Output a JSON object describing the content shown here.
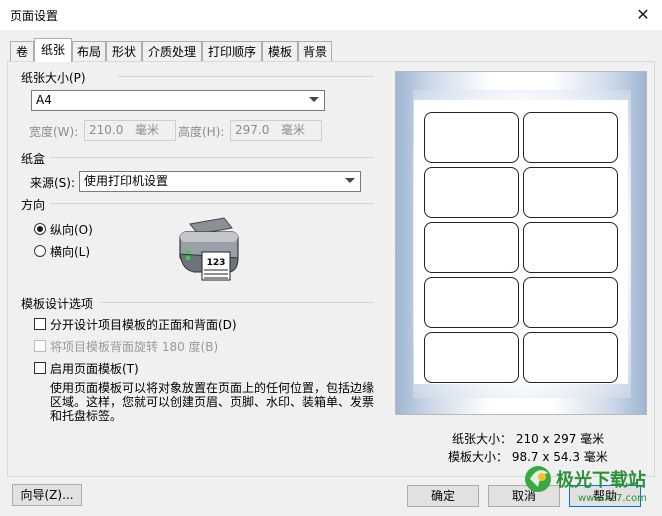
{
  "window": {
    "title": "页面设置",
    "close_glyph": "✕"
  },
  "tabs": [
    {
      "label": "卷"
    },
    {
      "label": "纸张"
    },
    {
      "label": "布局"
    },
    {
      "label": "形状"
    },
    {
      "label": "介质处理"
    },
    {
      "label": "打印顺序"
    },
    {
      "label": "模板"
    },
    {
      "label": "背景"
    }
  ],
  "active_tab": "纸张",
  "paper_size": {
    "group_label": "纸张大小(P)",
    "selected": "A4",
    "width_label": "宽度(W):",
    "width_value": "210.0",
    "width_unit": "毫米",
    "height_label": "高度(H):",
    "height_value": "297.0",
    "height_unit": "毫米"
  },
  "tray": {
    "group_label": "纸盒",
    "source_label": "来源(S):",
    "source_value": "使用打印机设置"
  },
  "orientation": {
    "group_label": "方向",
    "portrait_label": "纵向(O)",
    "landscape_label": "横向(L)",
    "selected": "portrait",
    "printer_paper_text": "123"
  },
  "template_options": {
    "group_label": "模板设计选项",
    "option1_label": "分开设计项目模板的正面和背面(D)",
    "option1_checked": false,
    "option2_label": "将项目模板背面旋转 180 度(B)",
    "option2_checked": false,
    "option2_enabled": false,
    "option3_label": "启用页面模板(T)",
    "option3_checked": false,
    "description_line1": "使用页面模板可以将对象放置在页面上的任何位置，包括边缘",
    "description_line2": "区域。这样，您就可以创建页眉、页脚、水印、装箱单、发票",
    "description_line3": "和托盘标签。"
  },
  "preview": {
    "label_rows": 5,
    "label_cols": 2,
    "paper_size_text": "纸张大小： 210 x 297 毫米",
    "template_size_text": "模板大小： 98.7 x 54.3 毫米"
  },
  "buttons": {
    "wizard": "向导(Z)...",
    "ok": "确定",
    "cancel": "取消",
    "help": "帮助"
  },
  "watermark": {
    "text": "极光下载站",
    "url": "www.xz7.com"
  },
  "colors": {
    "accent": "#0078d7",
    "preview_blue": "#9fb5d2",
    "watermark_green": "#3aa845"
  }
}
